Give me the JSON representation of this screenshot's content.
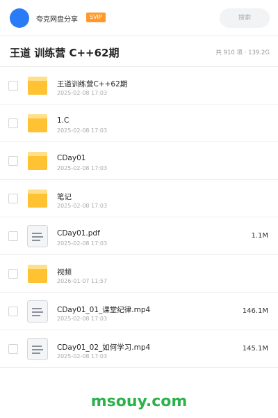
{
  "header": {
    "app_name": "夸克网盘分享",
    "vip_label": "SVIP",
    "search_placeholder": "搜索"
  },
  "folder": {
    "title": "王道 训练营 C++62期",
    "summary": "共 910 项 · 139.2G"
  },
  "files": [
    {
      "name": "王道训练营C++62期",
      "date": "2025-02-08 17:03",
      "type": "folder-icon",
      "size": ""
    },
    {
      "name": "1.C",
      "date": "2025-02-08 17:03",
      "type": "folder-icon",
      "size": ""
    },
    {
      "name": "CDay01",
      "date": "2025-02-08 17:03",
      "type": "folder-icon",
      "size": ""
    },
    {
      "name": "笔记",
      "date": "2025-02-08 17:03",
      "type": "folder-icon",
      "size": ""
    },
    {
      "name": "CDay01.pdf",
      "date": "2025-02-08 17:03",
      "type": "document-icon",
      "size": "1.1M"
    },
    {
      "name": "视频",
      "date": "2026-01-07 11:57",
      "type": "folder-icon",
      "size": ""
    },
    {
      "name": "CDay01_01_课堂纪律.mp4",
      "date": "2025-02-08 17:03",
      "type": "document-icon",
      "size": "146.1M"
    },
    {
      "name": "CDay01_02_如何学习.mp4",
      "date": "2025-02-08 17:03",
      "type": "document-icon",
      "size": "145.1M"
    }
  ],
  "watermark": "msouy.com",
  "colors": {
    "avatar": "#2a7bf6",
    "vip": "#ff9a2a",
    "folder": "#ffc233",
    "watermark": "#2bb34b"
  }
}
